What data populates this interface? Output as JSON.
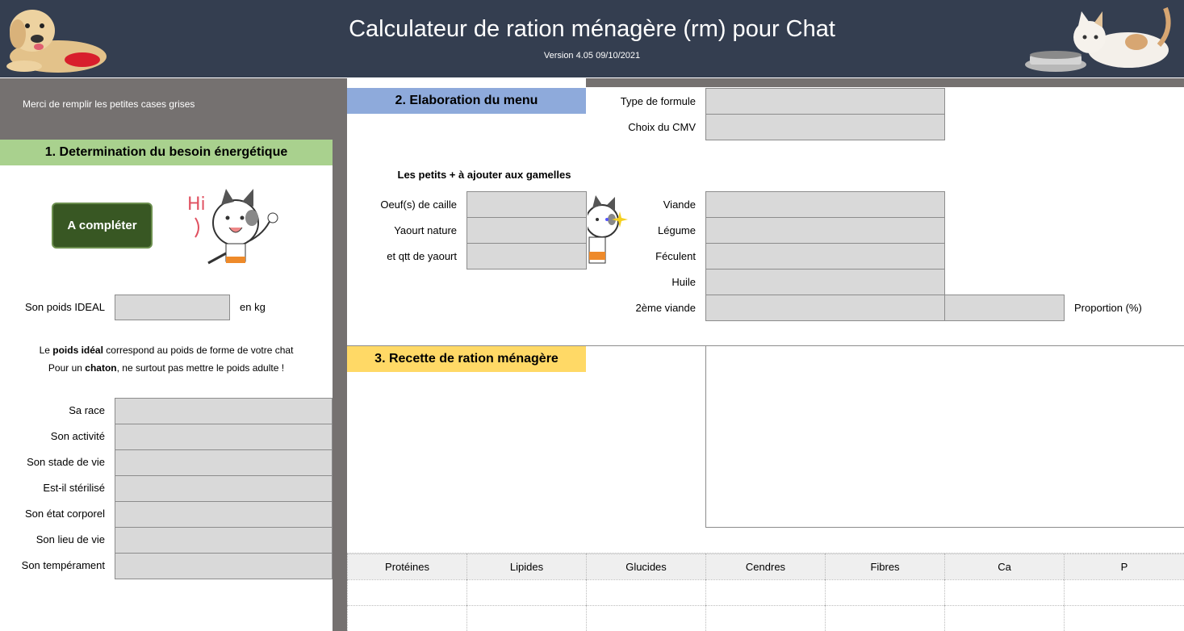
{
  "header": {
    "title": "Calculateur de ration ménagère (rm) pour Chat",
    "version": "Version 4.05 09/10/2021"
  },
  "instructions": "Merci de remplir les petites cases grises",
  "section1": {
    "title": "1. Determination du besoin énergétique",
    "button_label": "A compléter",
    "weight_label": "Son poids IDEAL",
    "weight_unit": "en kg",
    "note_line1_a": "Le ",
    "note_line1_b": "poids idéal",
    "note_line1_c": " correspond au poids de forme de votre chat",
    "note_line2_a": "Pour un ",
    "note_line2_b": "chaton",
    "note_line2_c": ", ne surtout pas mettre le poids adulte !",
    "fields": [
      "Sa race",
      "Son activité",
      "Son stade de vie",
      "Est-il stérilisé",
      "Son état corporel",
      "Son lieu de vie",
      "Son tempérament"
    ]
  },
  "section2": {
    "title": "2. Elaboration du menu",
    "type_formule": "Type de formule",
    "choix_cmv": "Choix du CMV",
    "extras_title": "Les petits + à ajouter aux gamelles",
    "extras": [
      "Oeuf(s) de caille",
      "Yaourt nature",
      "et qtt de yaourt"
    ],
    "ingredients": [
      "Viande",
      "Légume",
      "Féculent",
      "Huile",
      "2ème viande"
    ],
    "proportion_label": "Proportion (%)"
  },
  "section3": {
    "title": "3. Recette de ration ménagère"
  },
  "nutrients": [
    "Protéines",
    "Lipides",
    "Glucides",
    "Cendres",
    "Fibres",
    "Ca",
    "P"
  ],
  "colors": {
    "header_bg": "#343e50",
    "section1_bg": "#a9d18e",
    "section2_bg": "#8eaadb",
    "section3_bg": "#ffd966",
    "button_bg": "#385723",
    "field_bg": "#d9d9d9"
  }
}
